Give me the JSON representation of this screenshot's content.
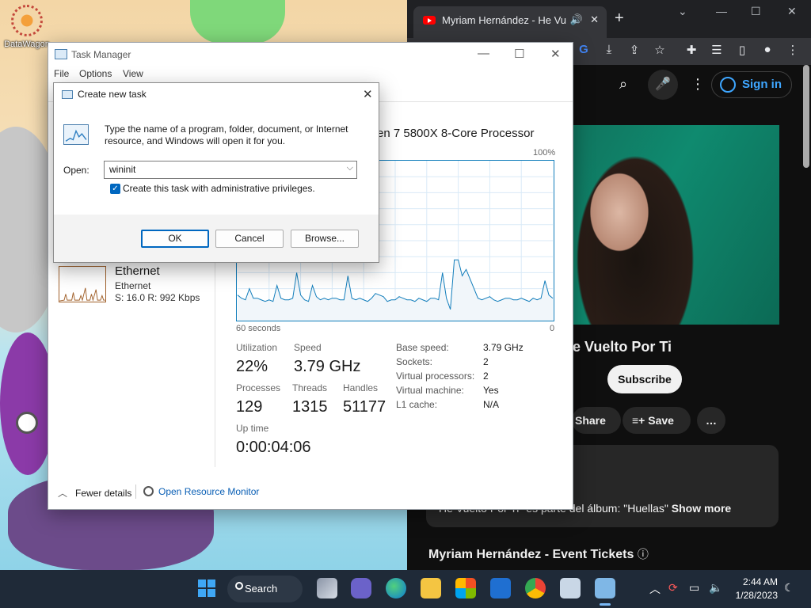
{
  "desktop": {
    "icon_label": "DataWagon"
  },
  "chrome": {
    "tab_title": "Myriam Hernández - He Vu",
    "audio_icon": "speaker-icon",
    "new_tab": "+",
    "youtube": {
      "sign_in": "Sign in",
      "video_title_partial": "le Vuelto Por Ti",
      "subscribe": "Subscribe",
      "share": "Share",
      "save": "Save",
      "more": "…",
      "description_partial": "He Vuelto Por Ti\" es parte del álbum: \"Huellas\"",
      "show_more": "Show more",
      "event_title": "Myriam Hernández - Event Tickets"
    }
  },
  "taskmanager": {
    "title": "Task Manager",
    "menu": [
      "File",
      "Options",
      "View"
    ],
    "ethernet": {
      "name": "Ethernet",
      "sub": "Ethernet",
      "speed": "S: 16.0  R: 992 Kbps"
    },
    "cpu": {
      "name": "yzen 7 5800X 8-Core Processor",
      "graph_max": "100%",
      "graph_left": "60 seconds",
      "graph_right": "0",
      "utilization_label": "Utilization",
      "utilization": "22%",
      "speed_label": "Speed",
      "speed": "3.79 GHz",
      "processes_label": "Processes",
      "processes": "129",
      "threads_label": "Threads",
      "threads": "1315",
      "handles_label": "Handles",
      "handles": "51177",
      "uptime_label": "Up time",
      "uptime": "0:00:04:06",
      "specs": [
        {
          "label": "Base speed:",
          "value": "3.79 GHz"
        },
        {
          "label": "Sockets:",
          "value": "2"
        },
        {
          "label": "Virtual processors:",
          "value": "2"
        },
        {
          "label": "Virtual machine:",
          "value": "Yes"
        },
        {
          "label": "L1 cache:",
          "value": "N/A"
        }
      ],
      "history": [
        16,
        14,
        13,
        20,
        14,
        14,
        13,
        12,
        13,
        12,
        22,
        14,
        13,
        13,
        14,
        30,
        16,
        13,
        12,
        22,
        15,
        13,
        14,
        13,
        14,
        14,
        13,
        13,
        28,
        14,
        13,
        14,
        13,
        12,
        14,
        17,
        16,
        15,
        12,
        13,
        13,
        15,
        14,
        13,
        13,
        12,
        14,
        13,
        12,
        14,
        14,
        13,
        30,
        14,
        7,
        38,
        38,
        28,
        32,
        26,
        20,
        14,
        13,
        14,
        15,
        13,
        12,
        13,
        14,
        14,
        13,
        13,
        14,
        13,
        12,
        14,
        13,
        14,
        25,
        16,
        14
      ]
    },
    "footer": {
      "fewer_details": "Fewer details",
      "resource_monitor": "Open Resource Monitor"
    }
  },
  "dialog": {
    "title": "Create new task",
    "message": "Type the name of a program, folder, document, or Internet resource, and Windows will open it for you.",
    "open_label": "Open:",
    "open_value": "wininit",
    "admin_checkbox": "Create this task with administrative privileges.",
    "admin_checked": true,
    "ok": "OK",
    "cancel": "Cancel",
    "browse": "Browse..."
  },
  "taskbar": {
    "search": "Search",
    "time": "2:44 AM",
    "date": "1/28/2023"
  },
  "colors": {
    "accent": "#0067c0",
    "cpu_line": "#117dbb",
    "ethernet_line": "#a1612b",
    "taskbar": "#1f2a38"
  }
}
